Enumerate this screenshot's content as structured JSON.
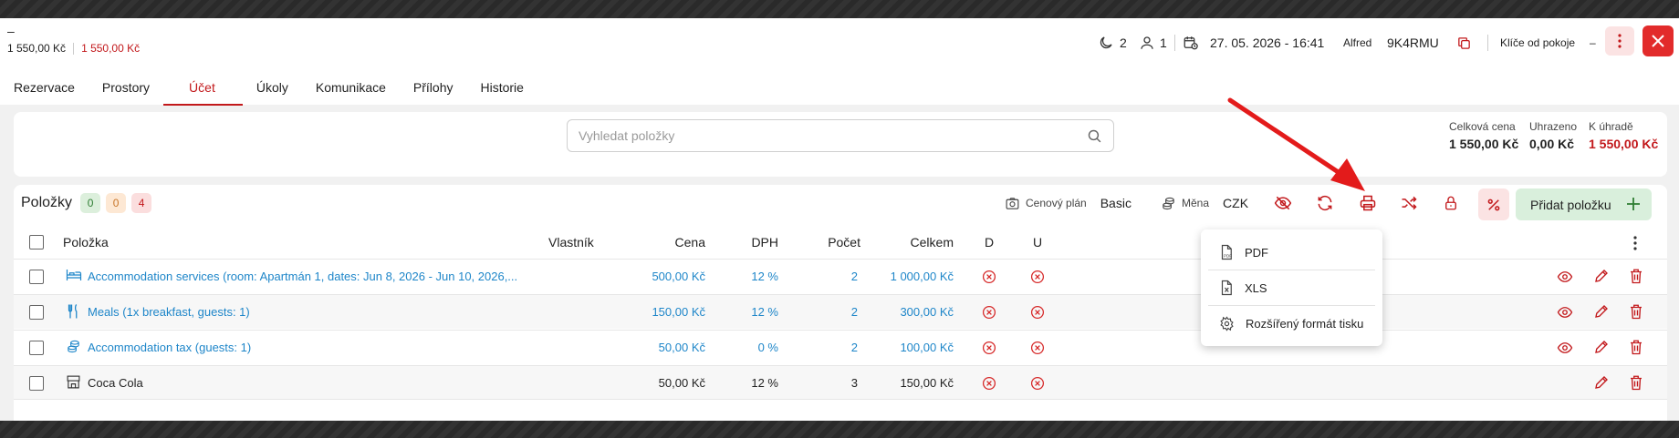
{
  "header": {
    "dash": "–",
    "price_total": "1 550,00 Kč",
    "price_due": "1 550,00 Kč",
    "nights": "2",
    "guests": "1",
    "datetime": "27. 05. 2026 - 16:41",
    "user": "Alfred",
    "code": "9K4RMU",
    "keys_label": "Klíče od pokoje",
    "keys_value": "–"
  },
  "tabs": [
    "Rezervace",
    "Prostory",
    "Účet",
    "Úkoly",
    "Komunikace",
    "Přílohy",
    "Historie"
  ],
  "active_tab": "Účet",
  "search": {
    "placeholder": "Vyhledat položky"
  },
  "totals": {
    "total_label": "Celková cena",
    "total_value": "1 550,00 Kč",
    "paid_label": "Uhrazeno",
    "paid_value": "0,00 Kč",
    "due_label": "K úhradě",
    "due_value": "1 550,00 Kč"
  },
  "items_panel": {
    "title": "Položky",
    "badge_green": "0",
    "badge_orange": "0",
    "badge_red": "4",
    "price_plan_label": "Cenový plán",
    "price_plan_value": "Basic",
    "currency_label": "Měna",
    "currency_value": "CZK",
    "add_label": "Přidat položku"
  },
  "table": {
    "columns": {
      "item": "Položka",
      "owner": "Vlastník",
      "price": "Cena",
      "vat": "DPH",
      "count": "Počet",
      "total": "Celkem",
      "d": "D",
      "u": "U"
    },
    "rows": [
      {
        "icon": "bed-icon",
        "name": "Accommodation services (room: Apartmán 1, dates: Jun 8, 2026 - Jun 10, 2026,...",
        "price": "500,00 Kč",
        "vat": "12 %",
        "count": "2",
        "total": "1 000,00 Kč",
        "link": true,
        "view": true
      },
      {
        "icon": "cutlery-icon",
        "name": "Meals (1x breakfast, guests: 1)",
        "price": "150,00 Kč",
        "vat": "12 %",
        "count": "2",
        "total": "300,00 Kč",
        "link": true,
        "view": true
      },
      {
        "icon": "coins-icon",
        "name": "Accommodation tax (guests: 1)",
        "price": "50,00 Kč",
        "vat": "0 %",
        "count": "2",
        "total": "100,00 Kč",
        "link": true,
        "view": true
      },
      {
        "icon": "shop-icon",
        "name": "Coca Cola",
        "price": "50,00 Kč",
        "vat": "12 %",
        "count": "3",
        "total": "150,00 Kč",
        "link": false,
        "view": false
      }
    ]
  },
  "print_menu": {
    "pdf": "PDF",
    "xls": "XLS",
    "extended": "Rozšířený formát tisku"
  },
  "colors": {
    "accent_red": "#c2181b",
    "link_blue": "#1e86c9",
    "add_green": "#d9efdc"
  }
}
